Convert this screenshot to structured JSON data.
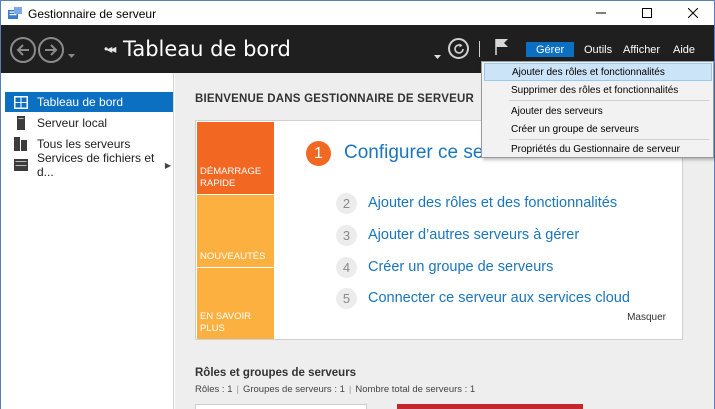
{
  "window": {
    "title": "Gestionnaire de serveur"
  },
  "toolbar": {
    "breadcrumb_arrows": "•◂◂",
    "breadcrumb_title": "Tableau de bord",
    "menus": [
      "Gérer",
      "Outils",
      "Afficher",
      "Aide"
    ]
  },
  "sidebar": {
    "items": [
      {
        "label": "Tableau de bord",
        "icon": "dashboard-icon",
        "active": true
      },
      {
        "label": "Serveur local",
        "icon": "local-server-icon"
      },
      {
        "label": "Tous les serveurs",
        "icon": "all-servers-icon"
      },
      {
        "label": "Services de fichiers et d...",
        "icon": "file-services-icon",
        "expandable": true
      }
    ]
  },
  "main": {
    "welcome": "BIENVENUE DANS GESTIONNAIRE DE SERVEUR",
    "tiles": [
      "DÉMARRAGE RAPIDE",
      "NOUVEAUTÉS",
      "EN SAVOIR PLUS"
    ],
    "headline_num": "1",
    "headline": "Configurer ce serv",
    "steps": [
      {
        "num": "2",
        "label": "Ajouter des rôles et des fonctionnalités"
      },
      {
        "num": "3",
        "label": "Ajouter d’autres serveurs à gérer"
      },
      {
        "num": "4",
        "label": "Créer un groupe de serveurs"
      },
      {
        "num": "5",
        "label": "Connecter ce serveur aux services cloud"
      }
    ],
    "hide": "Masquer",
    "roles_title": "Rôles et groupes de serveurs",
    "roles_stats": {
      "roles": "Rôles : 1",
      "groups": "Groupes de serveurs : 1",
      "total": "Nombre total de serveurs : 1"
    }
  },
  "dropdown": {
    "items": [
      "Ajouter des rôles et fonctionnalités",
      "Supprimer des rôles et fonctionnalités",
      "Ajouter des serveurs",
      "Créer un groupe de serveurs",
      "Propriétés du Gestionnaire de serveur"
    ],
    "highlighted_index": 0
  },
  "colors": {
    "accent": "#0b6fc2",
    "toolbar_bg": "#1f1f1f",
    "tile_orange": "#f26722",
    "tile_yellow": "#fbb040",
    "link_blue": "#1b75bc",
    "alert_red": "#c1272d"
  }
}
